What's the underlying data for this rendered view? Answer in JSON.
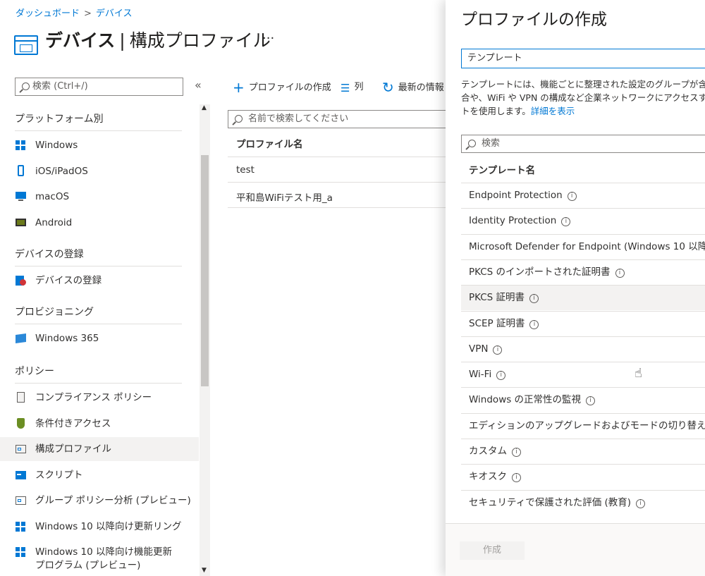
{
  "breadcrumb": [
    "ダッシュボード",
    "デバイス"
  ],
  "breadcrumb_sep": ">",
  "page": {
    "title_strong": "デバイス",
    "title_pipe": "|",
    "title_rest": "構成プロファイル",
    "more": "···"
  },
  "nav": {
    "search_placeholder": "検索 (Ctrl+/)",
    "collapse": "«",
    "sections": [
      {
        "title": "プラットフォーム別",
        "items": [
          {
            "label": "Windows",
            "icon": "windows-icon"
          },
          {
            "label": "iOS/iPadOS",
            "icon": "ios-device-icon"
          },
          {
            "label": "macOS",
            "icon": "macos-monitor-icon"
          },
          {
            "label": "Android",
            "icon": "android-device-icon"
          }
        ]
      },
      {
        "title": "デバイスの登録",
        "items": [
          {
            "label": "デバイスの登録",
            "icon": "device-enrollment-icon"
          }
        ]
      },
      {
        "title": "プロビジョニング",
        "items": [
          {
            "label": "Windows 365",
            "icon": "windows365-icon"
          }
        ]
      },
      {
        "title": "ポリシー",
        "items": [
          {
            "label": "コンプライアンス ポリシー",
            "icon": "compliance-policy-icon"
          },
          {
            "label": "条件付きアクセス",
            "icon": "conditional-access-shield-icon"
          },
          {
            "label": "構成プロファイル",
            "icon": "configuration-profile-icon",
            "active": true
          },
          {
            "label": "スクリプト",
            "icon": "script-icon"
          },
          {
            "label": "グループ ポリシー分析 (プレビュー)",
            "icon": "group-policy-analytics-icon"
          },
          {
            "label": "Windows 10 以降向け更新リング",
            "icon": "windows-icon"
          },
          {
            "label": "Windows 10 以降向け機能更新",
            "label2": "プログラム (プレビュー)",
            "icon": "windows-icon"
          }
        ]
      }
    ]
  },
  "toolbar": {
    "create": "プロファイルの作成",
    "columns": "列",
    "refresh": "最新の情報"
  },
  "content": {
    "search_placeholder": "名前で検索してください",
    "column_header": "プロファイル名",
    "rows": [
      "test",
      "平和島WiFiテスト用_a"
    ]
  },
  "panel": {
    "title": "プロファイルの作成",
    "template_value": "テンプレート",
    "description_lines": [
      "テンプレートには、機能ごとに整理された設定のグループが含ま",
      "合や、WiFi や VPN の構成など企業ネットワークにアクセスす",
      "トを使用します。"
    ],
    "learn_more": "詳細を表示",
    "search_placeholder": "検索",
    "column_header": "テンプレート名",
    "templates": [
      "Endpoint Protection",
      "Identity Protection",
      "Microsoft Defender for Endpoint (Windows 10 以降",
      "PKCS のインポートされた証明書",
      "PKCS 証明書",
      "SCEP 証明書",
      "VPN",
      "Wi-Fi",
      "Windows の正常性の監視",
      "エディションのアップグレードおよびモードの切り替え",
      "カスタム",
      "キオスク",
      "セキュリティで保護された評価 (教育)"
    ],
    "hovered_template": "PKCS 証明書",
    "create_button": "作成"
  },
  "colors": {
    "accent": "#0078d4",
    "text": "#323130",
    "divider": "#e1dfdd",
    "selected_bg": "#f3f2f1"
  }
}
